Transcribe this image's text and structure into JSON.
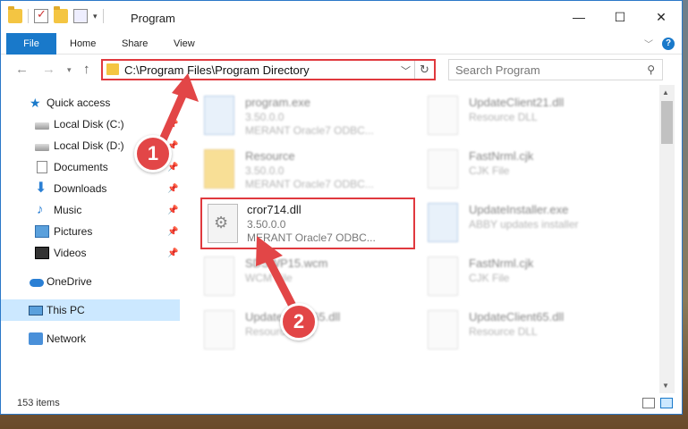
{
  "window": {
    "title": "Program",
    "buttons": {
      "minimize": "—",
      "maximize": "☐",
      "close": "✕"
    }
  },
  "ribbon": {
    "tabs": [
      "File",
      "Home",
      "Share",
      "View"
    ],
    "help": "?"
  },
  "navigation": {
    "address": "C:\\Program Files\\Program Directory",
    "search_placeholder": "Search Program"
  },
  "sidebar": {
    "items": [
      {
        "label": "Quick access",
        "icon": "star-icon",
        "pinned": false
      },
      {
        "label": "Local Disk (C:)",
        "icon": "drive-icon",
        "pinned": true
      },
      {
        "label": "Local Disk (D:)",
        "icon": "drive-icon",
        "pinned": true
      },
      {
        "label": "Documents",
        "icon": "documents-icon",
        "pinned": true
      },
      {
        "label": "Downloads",
        "icon": "download-icon",
        "pinned": true
      },
      {
        "label": "Music",
        "icon": "music-icon",
        "pinned": true
      },
      {
        "label": "Pictures",
        "icon": "pictures-icon",
        "pinned": true
      },
      {
        "label": "Videos",
        "icon": "videos-icon",
        "pinned": true
      },
      {
        "label": "OneDrive",
        "icon": "onedrive-icon",
        "pinned": false
      },
      {
        "label": "This PC",
        "icon": "computer-icon",
        "pinned": false
      },
      {
        "label": "Network",
        "icon": "network-icon",
        "pinned": false
      }
    ],
    "selected": "This PC"
  },
  "files": [
    {
      "name": "program.exe",
      "line2": "3.50.0.0",
      "line3": "MERANT Oracle7 ODBC...",
      "icon": "exe-icon"
    },
    {
      "name": "UpdateClient21.dll",
      "line2": "Resource DLL",
      "line3": "",
      "icon": "dll-icon"
    },
    {
      "name": "Resource",
      "line2": "3.50.0.0",
      "line3": "MERANT Oracle7 ODBC...",
      "icon": "folder-icon"
    },
    {
      "name": "FastNrml.cjk",
      "line2": "CJK File",
      "line3": "",
      "icon": "file-icon"
    },
    {
      "name": "cror714.dll",
      "line2": "3.50.0.0",
      "line3": "MERANT Oracle7 ODBC...",
      "icon": "dll-icon"
    },
    {
      "name": "UpdateInstaller.exe",
      "line2": "ABBY updates installer",
      "line3": "",
      "icon": "exe-icon"
    },
    {
      "name": "SDSWP15.wcm",
      "line2": "WCM File",
      "line3": "",
      "icon": "file-icon"
    },
    {
      "name": "FastNrml.cjk",
      "line2": "CJK File",
      "line3": "",
      "icon": "file-icon"
    },
    {
      "name": "UpdateClient65.dll",
      "line2": "Resource DLL",
      "line3": "",
      "icon": "dll-icon"
    },
    {
      "name": "UpdateClient65.dll",
      "line2": "Resource DLL",
      "line3": "",
      "icon": "dll-icon"
    }
  ],
  "highlighted_file": "cror714.dll",
  "status": {
    "items": "153 items"
  },
  "annotations": {
    "callout_1": "1",
    "callout_2": "2"
  },
  "colors": {
    "accent": "#1979ca",
    "highlight_red": "#e0393e",
    "selected_bg": "#cce8ff"
  }
}
